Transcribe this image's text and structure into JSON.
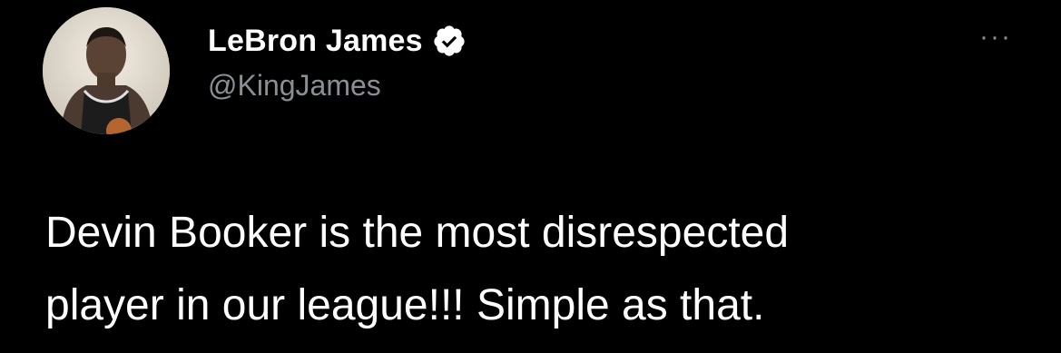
{
  "author": {
    "display_name": "LeBron James",
    "handle": "@KingJames",
    "verified": true
  },
  "icons": {
    "verified": "verified-check-icon",
    "more": "more-horizontal-icon",
    "more_glyph": "···"
  },
  "tweet": {
    "text": "Devin Booker is the most disrespected\nplayer in our league!!! Simple as that."
  },
  "colors": {
    "background": "#000000",
    "primary_text": "#ffffff",
    "secondary_text": "#8b8f94"
  }
}
